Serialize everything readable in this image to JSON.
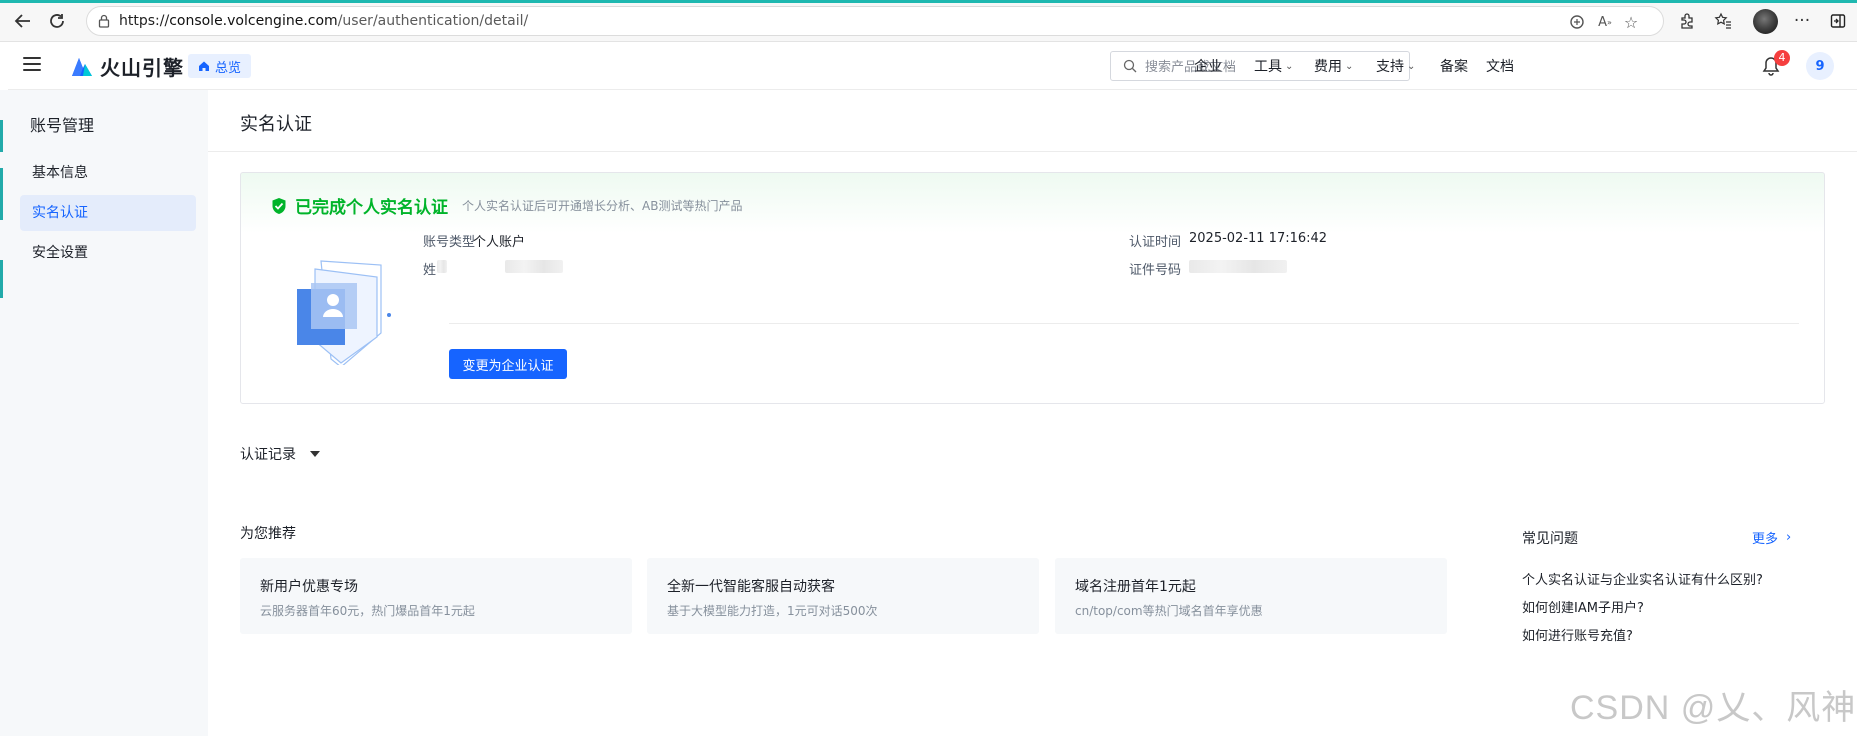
{
  "browser": {
    "url_scheme": "https://",
    "url_host": "console.volcengine.com",
    "url_path": "/user/authentication/detail/",
    "icons": [
      "back-arrow-icon",
      "reload-icon",
      "lock-icon",
      "translate-icon",
      "read-aloud-icon",
      "favorite-star-icon",
      "extensions-icon",
      "favorites-icon",
      "profile-avatar",
      "more-icon",
      "sidebar-icon"
    ]
  },
  "header": {
    "logo_text": "火山引擎",
    "overview_label": "总览",
    "search_placeholder": "搜索产品或文档",
    "nav": [
      {
        "label": "企业",
        "dropdown": true
      },
      {
        "label": "工具",
        "dropdown": true
      },
      {
        "label": "费用",
        "dropdown": true
      },
      {
        "label": "支持",
        "dropdown": true
      },
      {
        "label": "备案",
        "dropdown": false
      },
      {
        "label": "文档",
        "dropdown": false
      }
    ],
    "notification_count": "4",
    "user_initial": "9"
  },
  "sidebar": {
    "title": "账号管理",
    "items": [
      {
        "label": "基本信息",
        "active": false
      },
      {
        "label": "实名认证",
        "active": true
      },
      {
        "label": "安全设置",
        "active": false
      }
    ]
  },
  "main": {
    "title": "实名认证",
    "auth": {
      "status": "已完成个人实名认证",
      "description": "个人实名认证后可开通增长分析、AB测试等热门产品",
      "account_type_label": "账号类型",
      "account_type_value": "个人账户",
      "name_label": "姓",
      "auth_time_label": "认证时间",
      "auth_time_value": "2025-02-11 17:16:42",
      "id_label": "证件号码",
      "switch_button": "变更为企业认证"
    },
    "records_label": "认证记录",
    "recommend_title": "为您推荐",
    "recommend": [
      {
        "title": "新用户优惠专场",
        "desc": "云服务器首年60元，热门爆品首年1元起"
      },
      {
        "title": "全新一代智能客服自动获客",
        "desc": "基于大模型能力打造，1元可对话500次"
      },
      {
        "title": "域名注册首年1元起",
        "desc": "cn/top/com等热门域名首年享优惠"
      }
    ],
    "faq": {
      "title": "常见问题",
      "more": "更多",
      "items": [
        "个人实名认证与企业实名认证有什么区别?",
        "如何创建IAM子用户?",
        "如何进行账号充值?"
      ]
    }
  },
  "watermark": "CSDN @乂、风神",
  "colors": {
    "primary": "#1664ff",
    "success": "#00b42a",
    "sidebar_bg": "#f6f8fa",
    "danger": "#f53f3f"
  }
}
